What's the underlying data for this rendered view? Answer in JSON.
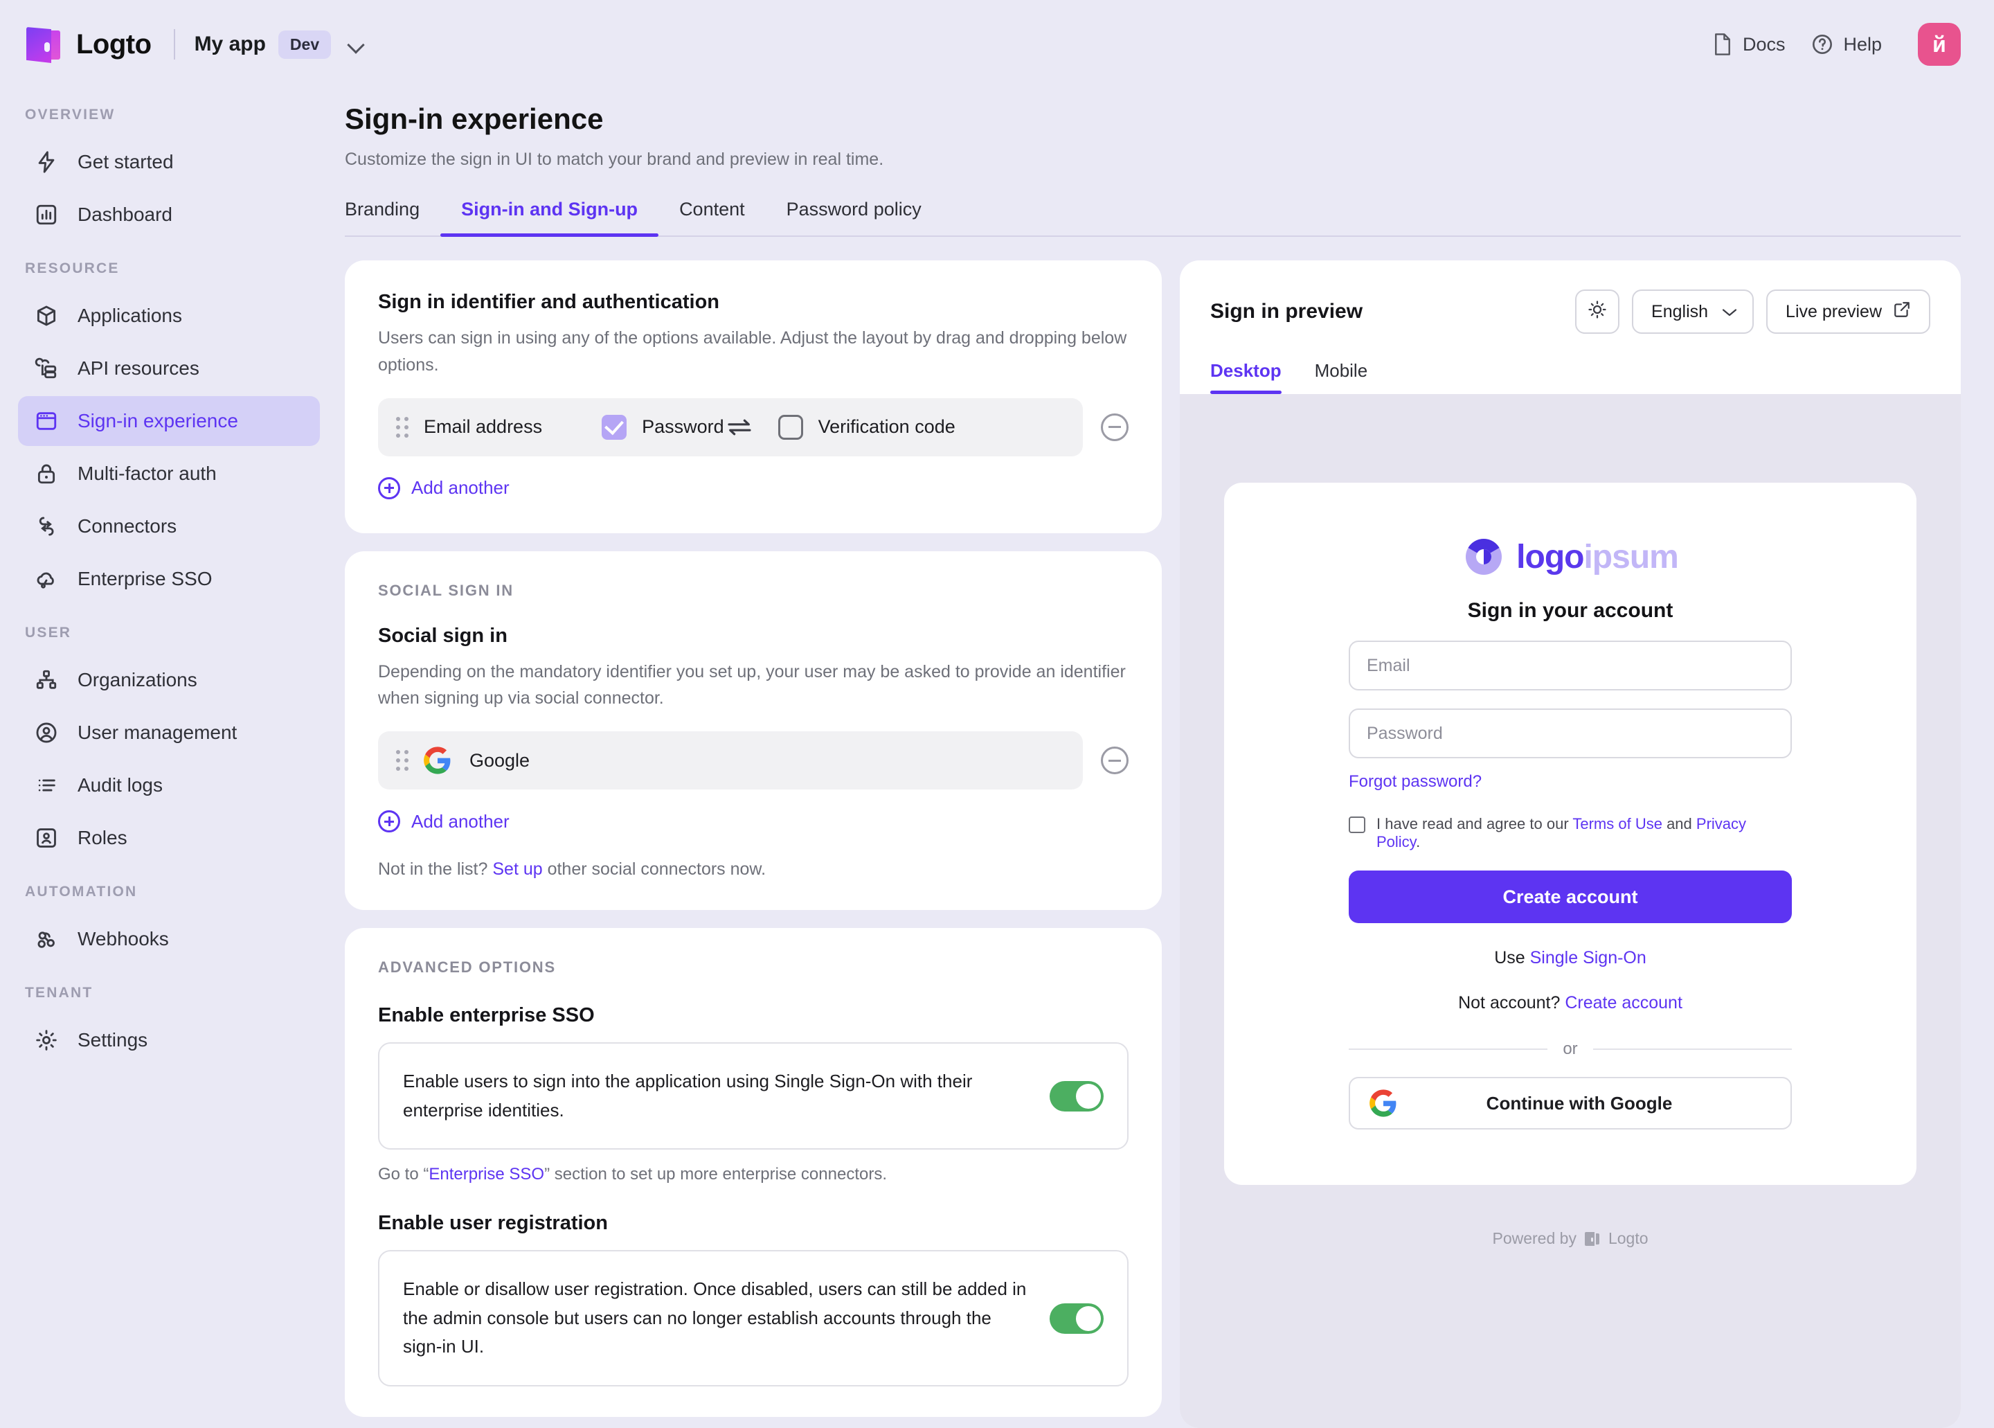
{
  "topbar": {
    "brand_name": "Logto",
    "app_name": "My app",
    "env_badge": "Dev",
    "docs_label": "Docs",
    "help_label": "Help",
    "avatar_initial": "й",
    "accent": "#5d34f2"
  },
  "sidebar": {
    "groups": [
      {
        "title": "Overview",
        "items": [
          {
            "label": "Get started",
            "icon": "bolt-icon",
            "active": false
          },
          {
            "label": "Dashboard",
            "icon": "chart-icon",
            "active": false
          }
        ]
      },
      {
        "title": "Resource",
        "items": [
          {
            "label": "Applications",
            "icon": "cube-icon",
            "active": false
          },
          {
            "label": "API resources",
            "icon": "api-icon",
            "active": false
          },
          {
            "label": "Sign-in experience",
            "icon": "browser-icon",
            "active": true
          },
          {
            "label": "Multi-factor auth",
            "icon": "lock-icon",
            "active": false
          },
          {
            "label": "Connectors",
            "icon": "connectors-icon",
            "active": false
          },
          {
            "label": "Enterprise SSO",
            "icon": "cloud-sso-icon",
            "active": false
          }
        ]
      },
      {
        "title": "User",
        "items": [
          {
            "label": "Organizations",
            "icon": "org-chart-icon",
            "active": false
          },
          {
            "label": "User management",
            "icon": "user-circle-icon",
            "active": false
          },
          {
            "label": "Audit logs",
            "icon": "list-icon",
            "active": false
          },
          {
            "label": "Roles",
            "icon": "badge-user-icon",
            "active": false
          }
        ]
      },
      {
        "title": "Automation",
        "items": [
          {
            "label": "Webhooks",
            "icon": "webhook-icon",
            "active": false
          }
        ]
      },
      {
        "title": "Tenant",
        "items": [
          {
            "label": "Settings",
            "icon": "gear-icon",
            "active": false
          }
        ]
      }
    ]
  },
  "page": {
    "title": "Sign-in experience",
    "subtitle": "Customize the sign in UI to match your brand and preview in real time.",
    "tabs": [
      {
        "label": "Branding",
        "active": false
      },
      {
        "label": "Sign-in and Sign-up",
        "active": true
      },
      {
        "label": "Content",
        "active": false
      },
      {
        "label": "Password policy",
        "active": false
      }
    ]
  },
  "identifier_card": {
    "heading": "Sign in identifier and authentication",
    "description": "Users can sign in using any of the options available. Adjust the layout by drag and dropping below options.",
    "row": {
      "identifier": "Email address",
      "password_label": "Password",
      "password_checked": true,
      "verification_label": "Verification code",
      "verification_checked": false
    },
    "add_another": "Add another"
  },
  "social_card": {
    "section_label": "Social sign in",
    "heading": "Social sign in",
    "description": "Depending on the mandatory identifier you set up, your user may be asked to provide an identifier when signing up via social connector.",
    "connectors": [
      {
        "name": "Google",
        "icon": "google-icon"
      }
    ],
    "add_another": "Add another",
    "footer_prefix": "Not in the list? ",
    "footer_link": "Set up",
    "footer_suffix": " other social connectors now."
  },
  "advanced_card": {
    "section_label": "Advanced options",
    "sso": {
      "heading": "Enable enterprise SSO",
      "description": "Enable users to sign into the application using Single Sign-On with their enterprise identities.",
      "enabled": true,
      "hint_prefix": "Go to “",
      "hint_link": "Enterprise SSO",
      "hint_suffix": "” section to set up more enterprise connectors."
    },
    "registration": {
      "heading": "Enable user registration",
      "description": "Enable or disallow user registration. Once disabled, users can still be added in the admin console but users can no longer establish accounts through the sign-in UI.",
      "enabled": true
    }
  },
  "preview": {
    "title": "Sign in preview",
    "theme_icon": "sun-icon",
    "language": "English",
    "live_preview": "Live preview",
    "tabs": [
      {
        "label": "Desktop",
        "active": true
      },
      {
        "label": "Mobile",
        "active": false
      }
    ],
    "signin": {
      "logo_primary": "logo",
      "logo_secondary": "ipsum",
      "title": "Sign in your account",
      "email_placeholder": "Email",
      "password_placeholder": "Password",
      "forgot_password": "Forgot password?",
      "terms_prefix": "I have read and agree to our ",
      "terms_link": "Terms of Use",
      "terms_and": " and ",
      "privacy_link": "Privacy Policy",
      "terms_end": ".",
      "primary_button": "Create account",
      "sso_prefix": "Use ",
      "sso_link": "Single Sign-On",
      "signup_prefix": "Not account? ",
      "signup_link": "Create account",
      "or_label": "or",
      "google_button": "Continue with Google",
      "powered_by": "Powered by",
      "powered_brand": "Logto"
    }
  }
}
